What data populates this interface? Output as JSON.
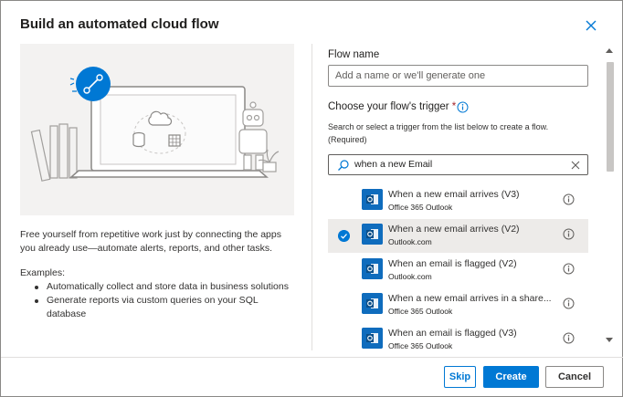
{
  "dialog": {
    "title": "Build an automated cloud flow",
    "close_icon": "close-icon"
  },
  "left": {
    "description": "Free yourself from repetitive work just by connecting the apps you already use—automate alerts, reports, and other tasks.",
    "examples_label": "Examples:",
    "examples": [
      "Automatically collect and store data in business solutions",
      "Generate reports via custom queries on your SQL database"
    ]
  },
  "form": {
    "flow_name_label": "Flow name",
    "flow_name_value": "",
    "flow_name_placeholder": "Add a name or we'll generate one",
    "trigger_label": "Choose your flow's trigger",
    "required_mark": "*",
    "trigger_help": "Search or select a trigger from the list below to create a flow. (Required)",
    "search_value": "when a new Email"
  },
  "triggers": [
    {
      "name": "When a new email arrives (V3)",
      "connector": "Office 365 Outlook",
      "selected": false
    },
    {
      "name": "When a new email arrives (V2)",
      "connector": "Outlook.com",
      "selected": true
    },
    {
      "name": "When an email is flagged (V2)",
      "connector": "Outlook.com",
      "selected": false
    },
    {
      "name": "When a new email arrives in a share...",
      "connector": "Office 365 Outlook",
      "selected": false
    },
    {
      "name": "When an email is flagged (V3)",
      "connector": "Office 365 Outlook",
      "selected": false
    }
  ],
  "footer": {
    "skip": "Skip",
    "create": "Create",
    "cancel": "Cancel"
  },
  "colors": {
    "accent": "#0078d4",
    "selected_row": "#edebe9",
    "outlook_icon": "#0f6cbd"
  }
}
